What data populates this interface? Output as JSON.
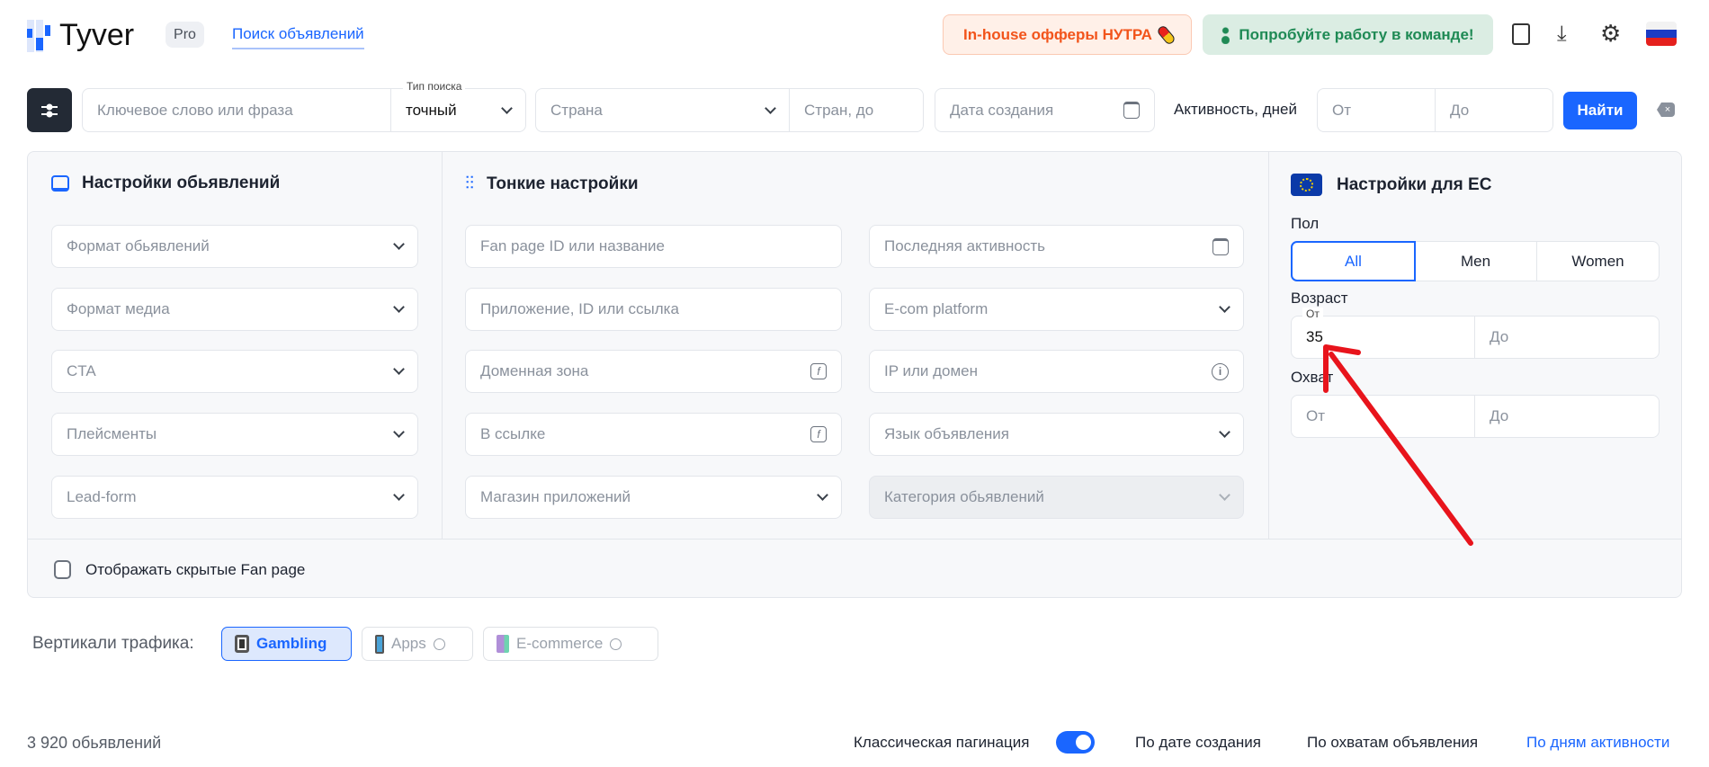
{
  "header": {
    "logo_text": "Tyver",
    "plan_badge": "Pro",
    "nav_link": "Поиск объявлений",
    "nutra_button": "In-house офферы НУТРА",
    "team_button": "Попробуйте работу в команде!"
  },
  "search": {
    "keyword_placeholder": "Ключевое слово или фраза",
    "search_type_label": "Тип поиска",
    "search_type_value": "точный",
    "country_placeholder": "Страна",
    "countries_to_placeholder": "Стран, до",
    "date_placeholder": "Дата создания",
    "activity_label": "Активность, дней",
    "from_placeholder": "От",
    "to_placeholder": "До",
    "find_button": "Найти"
  },
  "ad_settings": {
    "title": "Настройки обьявлений",
    "fields": [
      "Формат обьявлений",
      "Формат медиа",
      "CTA",
      "Плейсменты",
      "Lead-form"
    ]
  },
  "fine_settings": {
    "title": "Тонкие настройки",
    "left": [
      "Fan page ID или название",
      "Приложение, ID или ссылка",
      "Доменная зона",
      "В ссылке",
      "Магазин приложений"
    ],
    "right": [
      "Последняя активность",
      "E-com platform",
      "IP или домен",
      "Язык объявления",
      "Категория обьявлений"
    ]
  },
  "eu_settings": {
    "title": "Настройки для ЕС",
    "gender_label": "Пол",
    "gender_options": [
      "All",
      "Men",
      "Women"
    ],
    "gender_selected": "All",
    "age_label": "Возраст",
    "age_from_label": "От",
    "age_from_value": "35",
    "age_to_placeholder": "До",
    "reach_label": "Охват",
    "reach_from_placeholder": "От",
    "reach_to_placeholder": "До"
  },
  "hidden_fanpage_checkbox": {
    "label": "Отображать скрытые Fan page",
    "checked": false
  },
  "verticals": {
    "label": "Вертикали трафика:",
    "items": [
      {
        "label": "Gambling",
        "active": true
      },
      {
        "label": "Apps",
        "active": false
      },
      {
        "label": "E-commerce",
        "active": false
      }
    ]
  },
  "results": {
    "count": "3 920 обьявлений",
    "classic_pagination_label": "Классическая пагинация",
    "classic_pagination_on": true,
    "sort_options": [
      "По дате создания",
      "По охватам объявления",
      "По дням активности"
    ],
    "sort_active": "По дням активности"
  },
  "colors": {
    "accent": "#1a66ff",
    "dark": "#232a35",
    "nutra_text": "#f2541b",
    "team_text": "#1f8a55",
    "annotation_arrow": "#e8141c"
  }
}
